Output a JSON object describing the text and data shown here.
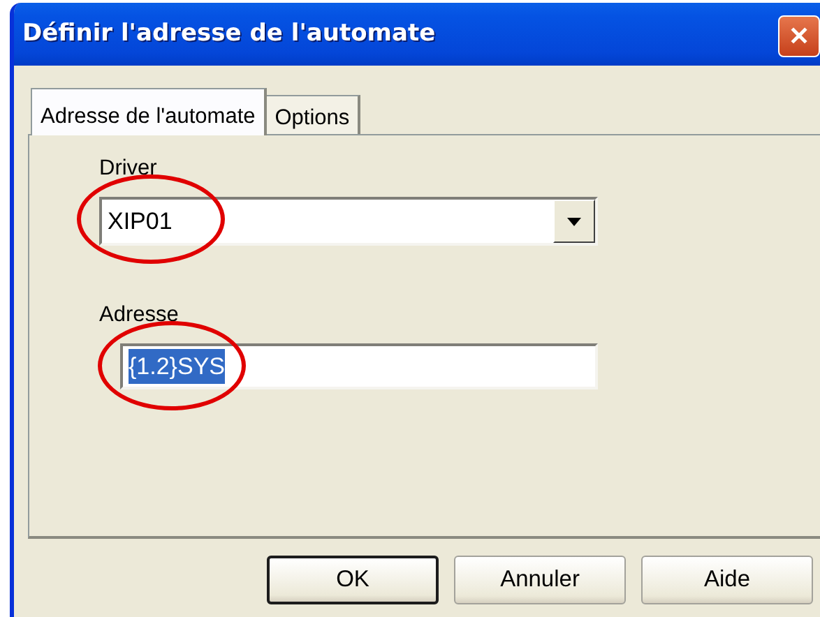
{
  "window": {
    "title": "Définir l'adresse de l'automate",
    "close_label": "✕"
  },
  "tabs": [
    {
      "label": "Adresse de l'automate",
      "selected": true
    },
    {
      "label": "Options",
      "selected": false
    }
  ],
  "fields": [
    {
      "kind": "combo",
      "label": "Driver",
      "value": "XIP01",
      "circled": true,
      "text_selected": false
    },
    {
      "kind": "text",
      "label": "Adresse",
      "value": "{1.2}SYS",
      "circled": true,
      "text_selected": true
    }
  ],
  "buttons": [
    {
      "label": "OK",
      "default": true
    },
    {
      "label": "Annuler",
      "default": false
    },
    {
      "label": "Aide",
      "default": false
    }
  ]
}
